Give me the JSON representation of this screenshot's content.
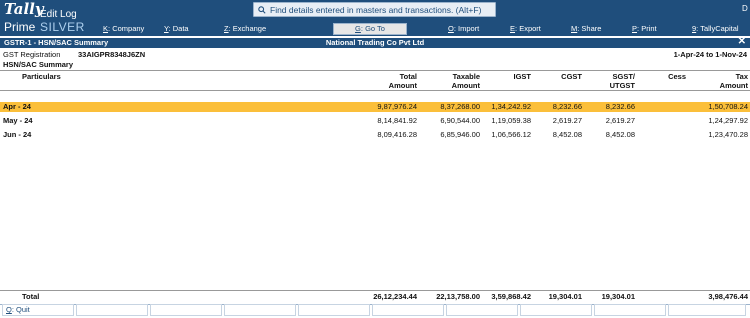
{
  "app": {
    "logo_top": "Tally",
    "logo_bottom": "Prime",
    "edition": "SILVER",
    "edit_log": "Edit Log",
    "search_placeholder": "Find details entered in masters and transactions. (Alt+F)",
    "top_right": "D"
  },
  "menu": [
    {
      "key": "K",
      "label": "Company"
    },
    {
      "key": "Y",
      "label": "Data"
    },
    {
      "key": "Z",
      "label": "Exchange"
    },
    {
      "key": "G",
      "label": "Go To"
    },
    {
      "key": "O",
      "label": "Import"
    },
    {
      "key": "E",
      "label": "Export"
    },
    {
      "key": "M",
      "label": "Share"
    },
    {
      "key": "P",
      "label": "Print"
    },
    {
      "key": "9",
      "label": "TallyCapital"
    }
  ],
  "report": {
    "title": "GSTR-1 - HSN/SAC Summary",
    "company": "National Trading Co Pvt Ltd",
    "close": "✕",
    "gst_label": "GST Registration",
    "gst_value": "33AIGPR8348J6ZN",
    "period": "1-Apr-24 to 1-Nov-24",
    "section": "HSN/SAC Summary"
  },
  "columns": {
    "particulars": "Particulars",
    "total_1": "Total",
    "total_2": "Amount",
    "taxable_1": "Taxable",
    "taxable_2": "Amount",
    "igst": "IGST",
    "cgst": "CGST",
    "sgst_1": "SGST/",
    "sgst_2": "UTGST",
    "cess": "Cess",
    "tax_1": "Tax",
    "tax_2": "Amount"
  },
  "rows": [
    {
      "label": "Apr - 24",
      "total": "9,87,976.24",
      "taxable": "8,37,268.00",
      "igst": "1,34,242.92",
      "cgst": "8,232.66",
      "sgst": "8,232.66",
      "cess": "",
      "tax": "1,50,708.24"
    },
    {
      "label": "May - 24",
      "total": "8,14,841.92",
      "taxable": "6,90,544.00",
      "igst": "1,19,059.38",
      "cgst": "2,619.27",
      "sgst": "2,619.27",
      "cess": "",
      "tax": "1,24,297.92"
    },
    {
      "label": "Jun - 24",
      "total": "8,09,416.28",
      "taxable": "6,85,946.00",
      "igst": "1,06,566.12",
      "cgst": "8,452.08",
      "sgst": "8,452.08",
      "cess": "",
      "tax": "1,23,470.28"
    }
  ],
  "total": {
    "label": "Total",
    "total": "26,12,234.44",
    "taxable": "22,13,758.00",
    "igst": "3,59,868.42",
    "cgst": "19,304.01",
    "sgst": "19,304.01",
    "tax": "3,98,476.44"
  },
  "footer": {
    "quit_key": "Q",
    "quit_label": "Quit"
  }
}
